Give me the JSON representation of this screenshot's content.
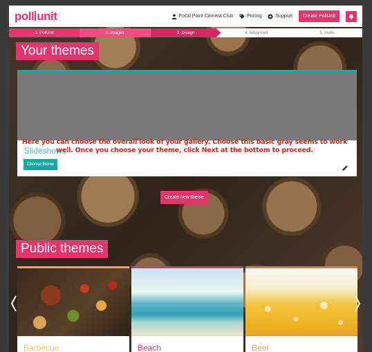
{
  "nav": {
    "logo": "pollunit",
    "account": "Focal Point Camera Club",
    "pricing": "Pricing",
    "support": "Support",
    "create_button": "Create PollUnit"
  },
  "steps": [
    {
      "label": "1. PollUnit"
    },
    {
      "label": "2. Images"
    },
    {
      "label": "3. Design"
    },
    {
      "label": "4. Advanced"
    },
    {
      "label": "5. Invite"
    }
  ],
  "your_themes": {
    "title": "Your themes",
    "card": {
      "name": "Slideshows",
      "choose_button": "Choose theme"
    },
    "annotation": "Here you can choose the overall look of your gallery. Choose this basic gray seems to work well. Once you choose your theme, click Next at the bottom to proceed.",
    "create_button": "Create new theme"
  },
  "public_themes": {
    "title": "Public themes",
    "cards": [
      {
        "name": "Barbecue"
      },
      {
        "name": "Beach"
      },
      {
        "name": "Beer"
      }
    ]
  },
  "colors": {
    "accent": "#e8336d",
    "teal": "#1ea5a0",
    "barbecue_bar": "#e9b12b",
    "beach_bar": "#e8336d",
    "beer_bar": "#e8762b"
  },
  "icons": [
    "user-icon",
    "tag-icon",
    "lifebuoy-icon",
    "bell-icon",
    "pencil-icon",
    "chevron-left-icon",
    "chevron-right-icon"
  ]
}
